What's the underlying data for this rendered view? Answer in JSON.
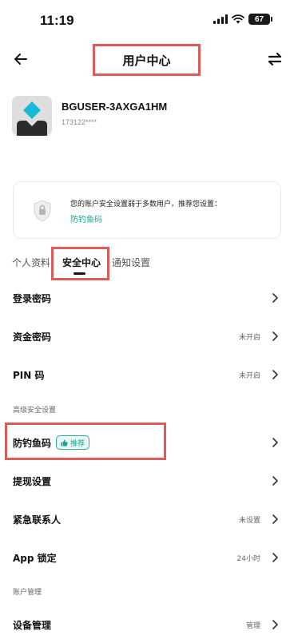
{
  "status_bar": {
    "time": "11:19",
    "battery": "67"
  },
  "nav": {
    "title": "用户中心",
    "back_icon": "back-arrow-icon",
    "swap_icon": "swap-icon"
  },
  "profile": {
    "username": "BGUSER-3AXGA1HM",
    "user_id": "173122****"
  },
  "alert": {
    "message": "您的账户安全设置弱于多数用户，推荐您设置：",
    "link": "防钓鱼码"
  },
  "tabs": {
    "profile": "个人资料",
    "security": "安全中心",
    "notify": "通知设置",
    "active": "安全中心"
  },
  "rows": {
    "login_password": {
      "label": "登录密码"
    },
    "fund_password": {
      "label": "资金密码",
      "value": "未开启"
    },
    "pin": {
      "label": "PIN 码",
      "value": "未开启"
    },
    "advanced_header": "高级安全设置",
    "anti_phishing": {
      "label": "防钓鱼码",
      "badge": "推荐"
    },
    "withdraw": {
      "label": "提现设置"
    },
    "emergency": {
      "label": "紧急联系人",
      "value": "未设置"
    },
    "app_lock": {
      "label": "App 锁定",
      "value": "24小时"
    },
    "account_header": "账户管理",
    "device": {
      "label": "设备管理",
      "value": "管理"
    }
  },
  "colors": {
    "accent": "#16a89a",
    "highlight": "#e05a5a",
    "text": "#111111",
    "muted": "#666666"
  }
}
